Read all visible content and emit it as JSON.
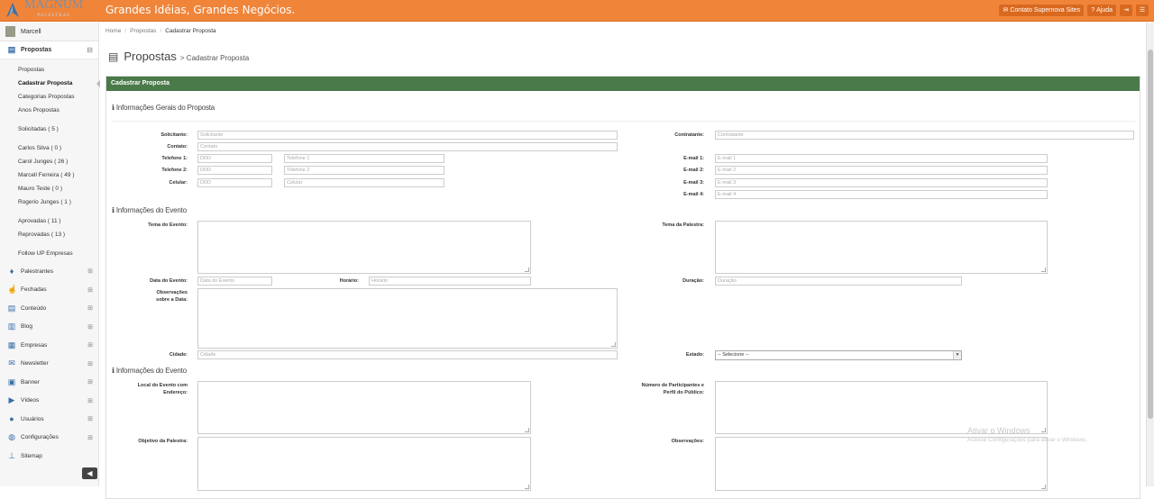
{
  "header": {
    "logo_text": "MAGNUM",
    "logo_sub": "PALESTRAS",
    "slogan": "Grandes Idéias, Grandes Negócios.",
    "contact_button": "Contato Supernova Sites",
    "help_button": "Ajuda",
    "accent_color": "#f0853a"
  },
  "sidebar": {
    "user": "Marcell",
    "propostas_label": "Propostas",
    "propostas_items": [
      "Propostas",
      "Cadastrar Proposta",
      "Categorias Propostas",
      "Anos Propostas"
    ],
    "solicitadas": "Solicitadas ( 5 )",
    "user_items": [
      "Carlos Silva ( 0 )",
      "Carol Junges ( 26 )",
      "Marcell Ferreira ( 49 )",
      "Mauro Teste ( 0 )",
      "Rogerio Junges ( 1 )"
    ],
    "aprovadas": "Aprovadas ( 11 )",
    "reprovadas": "Reprovadas ( 13 )",
    "follow_up": "Follow UP Empresas",
    "items": [
      {
        "label": "Palestrantes",
        "icon": "microphone-icon"
      },
      {
        "label": "Fechadas",
        "icon": "thumbs-up-icon"
      },
      {
        "label": "Conteúdo",
        "icon": "file-icon"
      },
      {
        "label": "Blog",
        "icon": "book-icon"
      },
      {
        "label": "Empresas",
        "icon": "bank-icon"
      },
      {
        "label": "Newsletter",
        "icon": "envelope-icon"
      },
      {
        "label": "Banner",
        "icon": "image-icon"
      },
      {
        "label": "Vídeos",
        "icon": "video-icon"
      },
      {
        "label": "Usuários",
        "icon": "user-icon"
      },
      {
        "label": "Configurações",
        "icon": "globe-icon"
      },
      {
        "label": "Sitemap",
        "icon": "sitemap-icon"
      }
    ]
  },
  "breadcrumb": {
    "home": "Home",
    "section": "Propostas",
    "current": "Cadastrar Proposta"
  },
  "page": {
    "title": "Propostas",
    "subtitle": "Cadastrar Proposta"
  },
  "panel": {
    "title": "Cadastrar Proposta"
  },
  "form": {
    "section1": "Informações Gerais do Proposta",
    "solicitante_label": "Solicitante:",
    "solicitante_ph": "Solicitante",
    "contato_label": "Contato:",
    "contato_ph": "Contato",
    "telefone1_label": "Telefone 1:",
    "telefone2_label": "Telefone 2:",
    "celular_label": "Celular:",
    "ddd_ph": "DDD",
    "telefone1_ph": "Telefone 1",
    "telefone2_ph": "Telefone 2",
    "celular_ph": "Celular",
    "contratante_label": "Contratante:",
    "contratante_ph": "Contratante",
    "email1_label": "E-mail 1:",
    "email2_label": "E-mail 2:",
    "email3_label": "E-mail 3:",
    "email4_label": "E-mail 4:",
    "email1_ph": "E-mail 1",
    "email2_ph": "E-mail 2",
    "email3_ph": "E-mail 3",
    "email4_ph": "E-mail 4",
    "section2": "Informações do Evento",
    "tema_evento_label": "Tema do Evento:",
    "tema_palestra_label": "Tema da Palestra:",
    "data_evento_label": "Data do Evento:",
    "data_evento_ph": "Data do Evento",
    "horario_label": "Horário:",
    "horario_ph": "Horário",
    "duracao_label": "Duração:",
    "duracao_ph": "Duração",
    "obs_data_label": "Observações sobre a Data:",
    "cidade_label": "Cidade:",
    "cidade_ph": "Cidade",
    "estado_label": "Estado:",
    "estado_value": "-- Selecione --",
    "section3": "Informações do Evento",
    "local_label": "Local do Evento com Endereço:",
    "participantes_label": "Número de Participantes e Perfil do Público:",
    "objetivo_label": "Objetivo da Palestra:",
    "observacoes_label": "Observações:"
  },
  "watermark": {
    "line1": "Ativar o Windows",
    "line2": "Acesse Configurações para ativar o Windows."
  }
}
